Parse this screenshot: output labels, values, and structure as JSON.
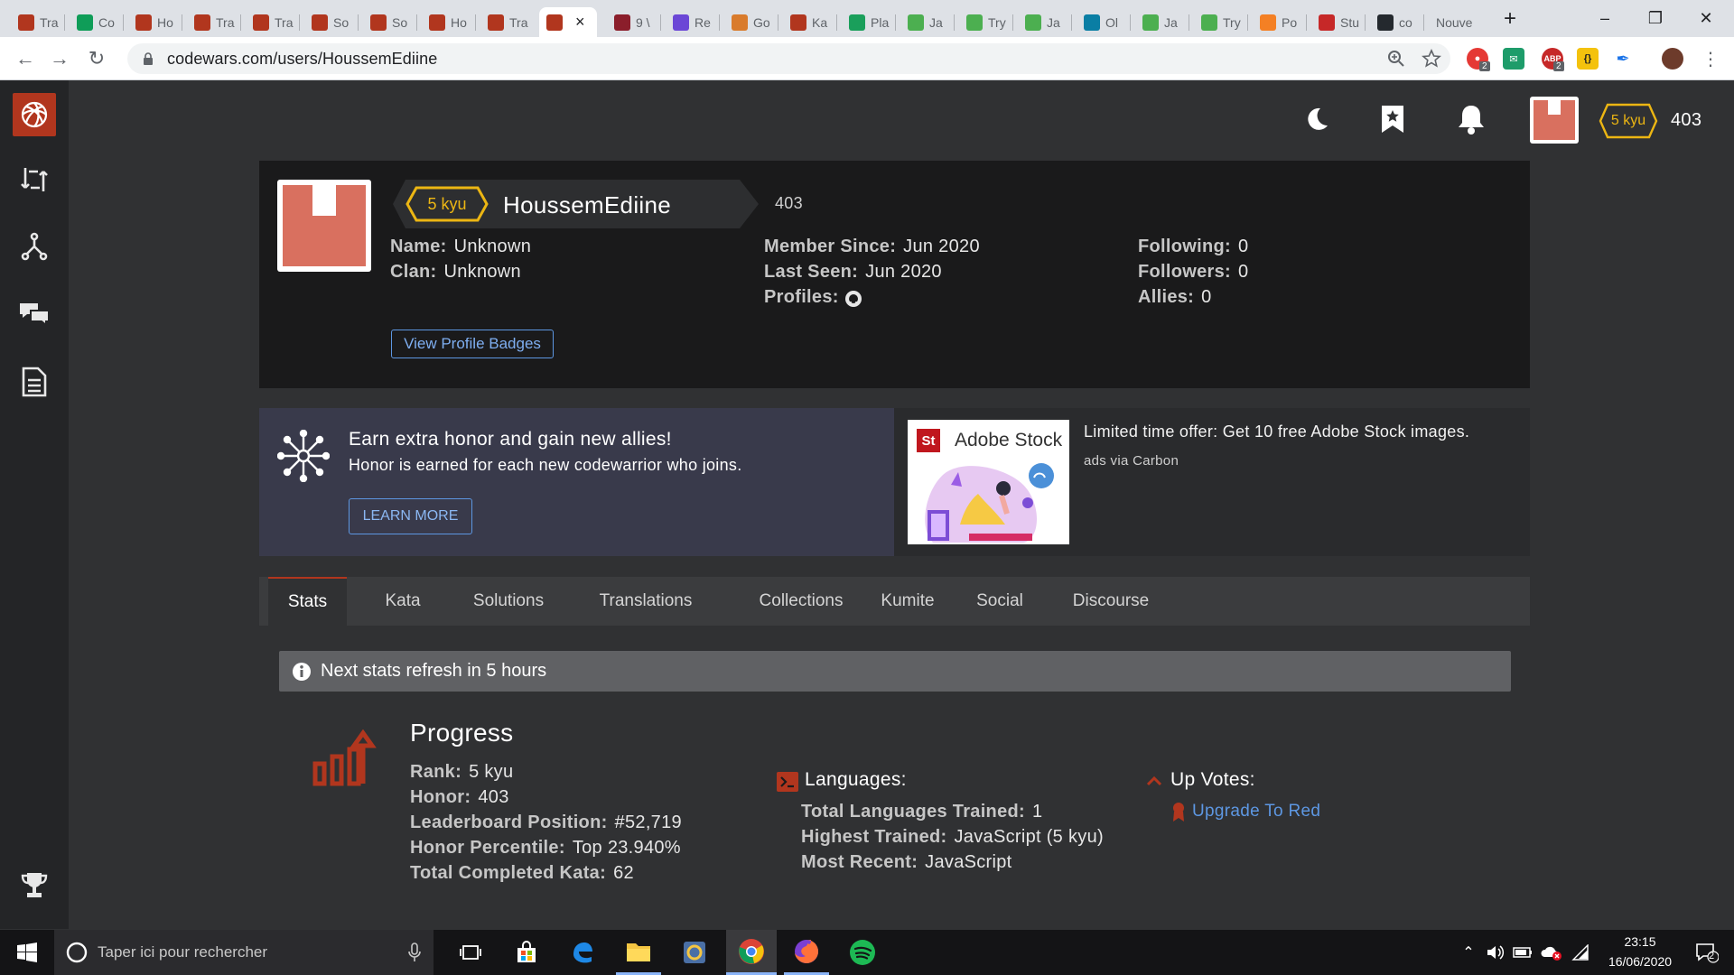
{
  "browser": {
    "tabs": [
      {
        "title": "Tra",
        "icon": "codewars-icon",
        "color": "#b1361e"
      },
      {
        "title": "Co",
        "icon": "sheets-icon",
        "color": "#0f9d58"
      },
      {
        "title": "Ho",
        "icon": "codewars-icon",
        "color": "#b1361e"
      },
      {
        "title": "Tra",
        "icon": "codewars-icon",
        "color": "#b1361e"
      },
      {
        "title": "Tra",
        "icon": "codewars-icon",
        "color": "#b1361e"
      },
      {
        "title": "So",
        "icon": "codewars-icon",
        "color": "#b1361e"
      },
      {
        "title": "So",
        "icon": "codewars-icon",
        "color": "#b1361e"
      },
      {
        "title": "Ho",
        "icon": "codewars-icon",
        "color": "#b1361e"
      },
      {
        "title": "Tra",
        "icon": "codewars-icon",
        "color": "#b1361e"
      },
      {
        "title": "",
        "icon": "codewars-icon",
        "color": "#b1361e",
        "active": true
      },
      {
        "title": "9 \\",
        "icon": "heart-icon",
        "color": "#8b1e2b"
      },
      {
        "title": "Re",
        "icon": "pulse-icon",
        "color": "#6b47d6"
      },
      {
        "title": "Go",
        "icon": "cookie-icon",
        "color": "#d97b2c"
      },
      {
        "title": "Ka",
        "icon": "codewars-icon",
        "color": "#b1361e"
      },
      {
        "title": "Pla",
        "icon": "play-icon",
        "color": "#1a9f5b"
      },
      {
        "title": "Ja",
        "icon": "w3-icon",
        "color": "#4caf50"
      },
      {
        "title": "Try",
        "icon": "w3-icon",
        "color": "#4caf50"
      },
      {
        "title": "Ja",
        "icon": "w3-icon",
        "color": "#4caf50"
      },
      {
        "title": "Ol",
        "icon": "chat-icon",
        "color": "#0a7ea4"
      },
      {
        "title": "Ja",
        "icon": "w3-icon",
        "color": "#4caf50"
      },
      {
        "title": "Try",
        "icon": "w3-icon",
        "color": "#4caf50"
      },
      {
        "title": "Po",
        "icon": "stack-icon",
        "color": "#f48024"
      },
      {
        "title": "Stu",
        "icon": "brace-icon",
        "color": "#c62828"
      },
      {
        "title": "co",
        "icon": "github-icon",
        "color": "#24292e"
      },
      {
        "title": "Nouve",
        "icon": "",
        "color": ""
      }
    ],
    "new_tab": "+",
    "url": "codewars.com/users/HoussemEdiine",
    "ext_badges": [
      "2",
      "2"
    ]
  },
  "header": {
    "rank": "5 kyu",
    "honor": "403"
  },
  "profile": {
    "rank": "5 kyu",
    "username": "HoussemEdiine",
    "honor": "403",
    "name_label": "Name:",
    "name_value": "Unknown",
    "clan_label": "Clan:",
    "clan_value": "Unknown",
    "member_since_label": "Member Since:",
    "member_since_value": "Jun 2020",
    "last_seen_label": "Last Seen:",
    "last_seen_value": "Jun 2020",
    "profiles_label": "Profiles:",
    "following_label": "Following:",
    "following_value": "0",
    "followers_label": "Followers:",
    "followers_value": "0",
    "allies_label": "Allies:",
    "allies_value": "0",
    "badges_button": "View Profile Badges"
  },
  "banner": {
    "title": "Earn extra honor and gain new allies!",
    "subtitle": "Honor is earned for each new codewarrior who joins.",
    "button": "LEARN MORE"
  },
  "ad": {
    "brand_mark": "St",
    "brand": "Adobe Stock",
    "text": "Limited time offer: Get 10 free Adobe Stock images.",
    "via": "ads via Carbon"
  },
  "profile_tabs": [
    "Stats",
    "Kata",
    "Solutions",
    "Translations",
    "Collections",
    "Kumite",
    "Social",
    "Discourse"
  ],
  "notice": "Next stats refresh in 5 hours",
  "progress": {
    "title": "Progress",
    "rank_label": "Rank:",
    "rank_value": "5 kyu",
    "honor_label": "Honor:",
    "honor_value": "403",
    "leaderboard_label": "Leaderboard Position:",
    "leaderboard_value": "#52,719",
    "percentile_label": "Honor Percentile:",
    "percentile_value": "Top 23.940%",
    "completed_label": "Total Completed Kata:",
    "completed_value": "62"
  },
  "languages": {
    "title": "Languages:",
    "trained_label": "Total Languages Trained:",
    "trained_value": "1",
    "highest_label": "Highest Trained:",
    "highest_value": "JavaScript (5 kyu)",
    "recent_label": "Most Recent:",
    "recent_value": "JavaScript"
  },
  "upvotes": {
    "title": "Up Votes:",
    "link": "Upgrade To Red"
  },
  "taskbar": {
    "search_placeholder": "Taper ici pour rechercher",
    "time": "23:15",
    "date": "16/06/2020",
    "notif_count": "2"
  },
  "colors": {
    "brand_red": "#b1361e",
    "kyu_yellow": "#ecb613",
    "link_blue": "#5d97e2",
    "avatar": "#d9705f"
  }
}
